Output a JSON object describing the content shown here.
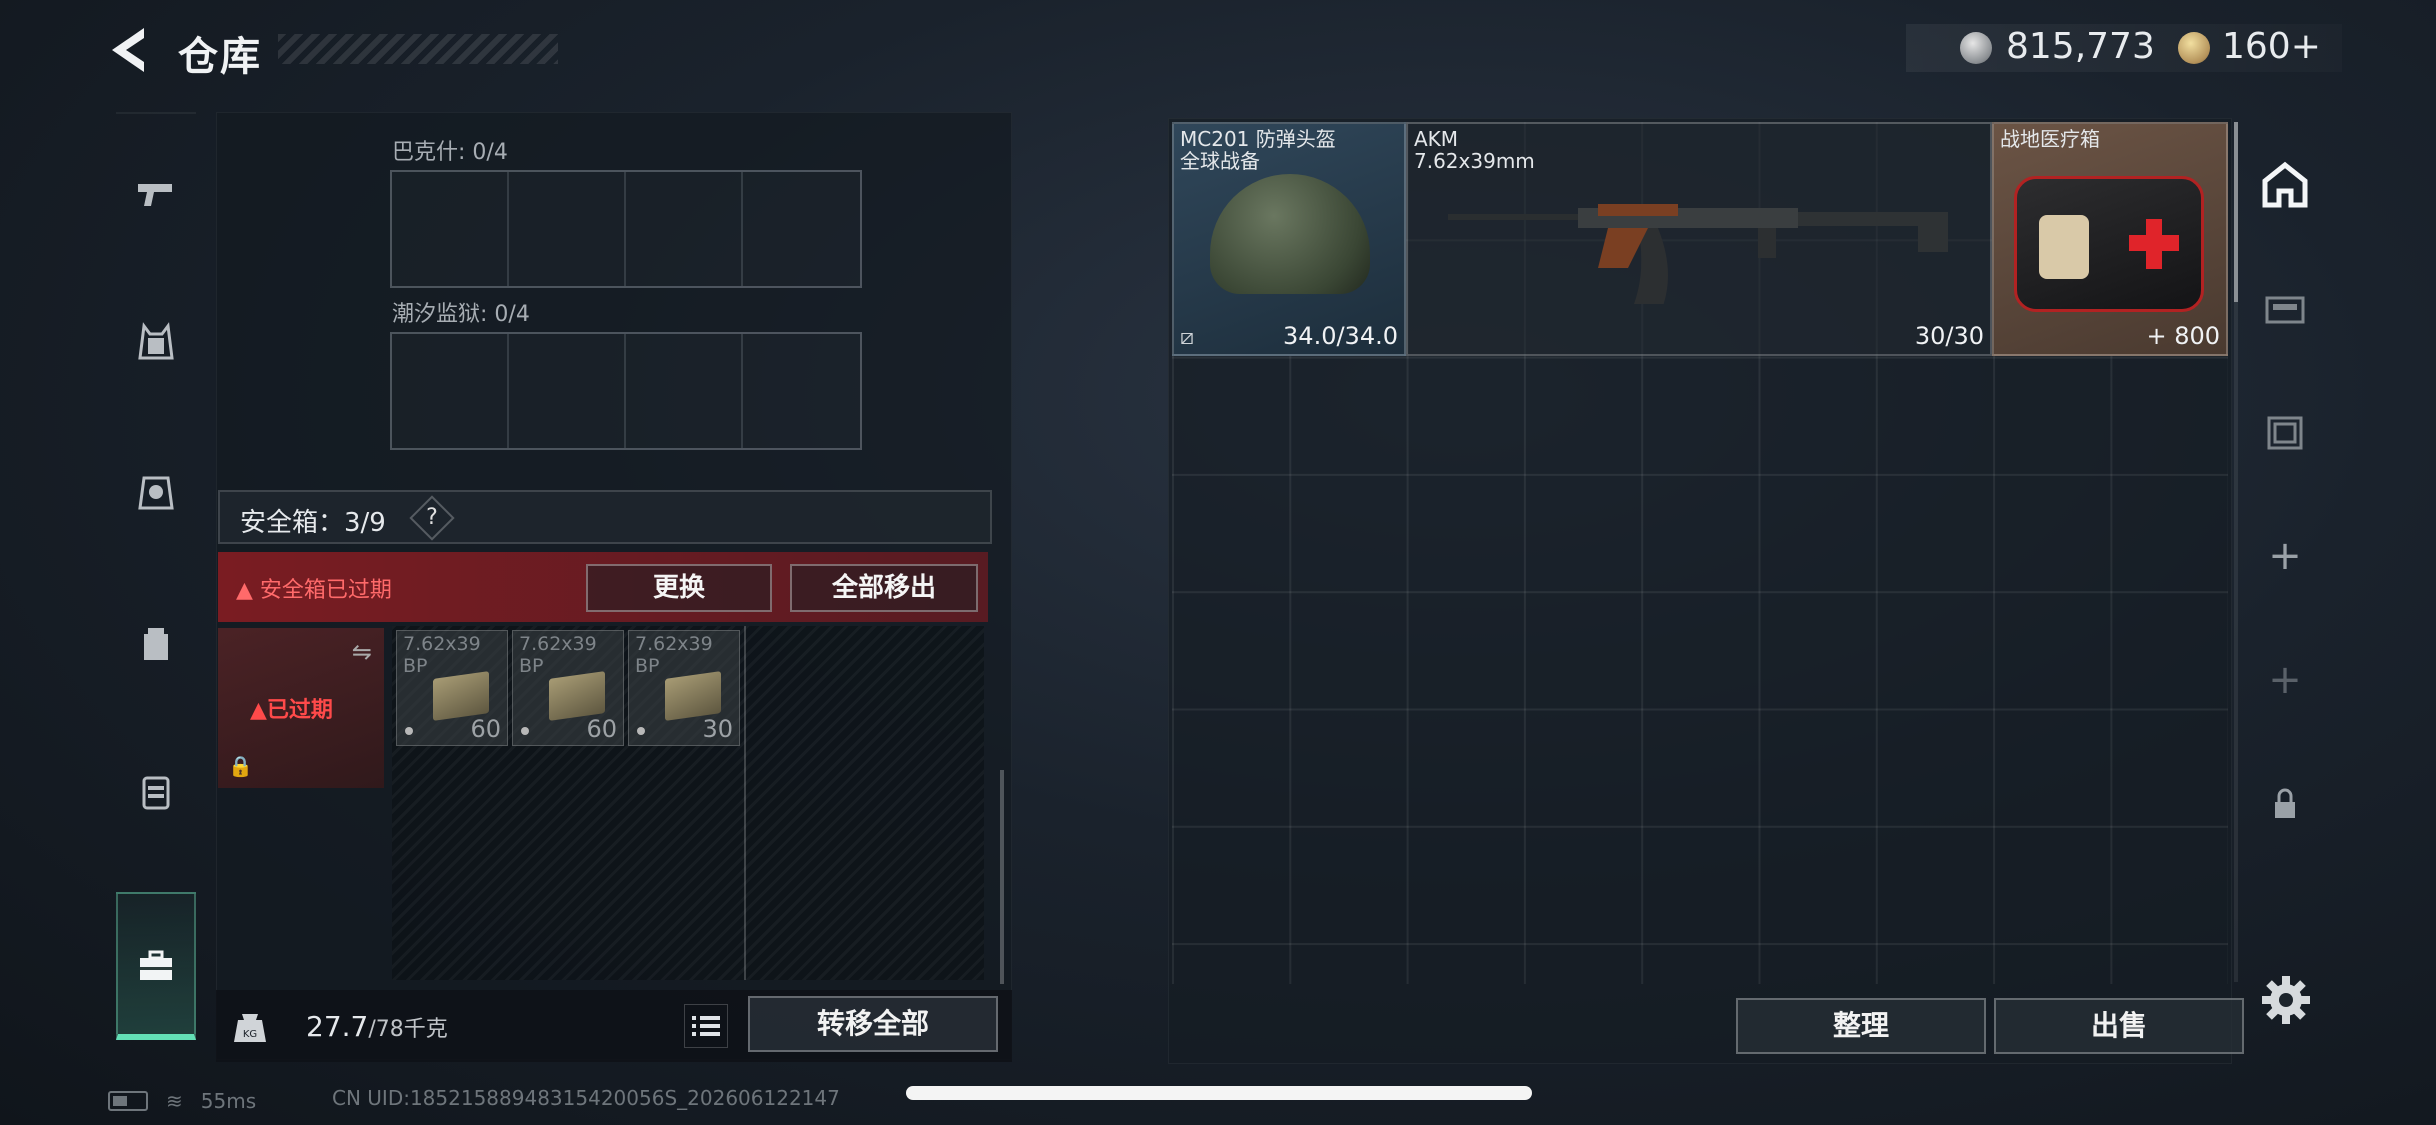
{
  "header": {
    "title": "仓库",
    "currencies": [
      {
        "name": "silver-coin",
        "amount": "815,773"
      },
      {
        "name": "gold-coin",
        "amount": "160+"
      }
    ]
  },
  "left_nav": {
    "items": [
      "pistol-icon",
      "armor-vest-icon",
      "chest-rig-icon",
      "backpack-icon",
      "case-icon",
      "toolbox-icon"
    ],
    "active": "toolbox-icon",
    "accent_color": "#63e0b6"
  },
  "key_slots": [
    {
      "label": "巴克什: 0/4"
    },
    {
      "label": "潮汐监狱: 0/4"
    }
  ],
  "safe_box": {
    "title": "安全箱：3/9",
    "help": "?",
    "expired_warning": "安全箱已过期",
    "replace_label": "更换",
    "move_all_out_label": "全部移出",
    "expired_badge": "已过期",
    "items": [
      {
        "name": "7.62x39\nBP",
        "qty": "60"
      },
      {
        "name": "7.62x39\nBP",
        "qty": "60"
      },
      {
        "name": "7.62x39\nBP",
        "qty": "30"
      }
    ]
  },
  "weight": {
    "current": "27.7",
    "max": "/78千克"
  },
  "transfer_all_label": "转移全部",
  "stash": {
    "items": [
      {
        "name": "MC201 防弹头盔\n全球战备",
        "bottom": "34.0/34.0"
      },
      {
        "name": "AKM\n7.62x39mm",
        "bottom": "30/30"
      },
      {
        "name": "战地医疗箱",
        "bottom": "+ 800"
      }
    ],
    "sort_label": "整理",
    "sell_label": "出售"
  },
  "right_rail": [
    "stash-icon",
    "container-icon",
    "container-icon",
    "+",
    "+",
    "lock-icon"
  ],
  "status_bar": {
    "ping": "55ms",
    "uid": "CN UID:18521588948315420056S_202606122147"
  },
  "colors": {
    "danger": "#ff4a4a",
    "accent": "#63e0b6"
  }
}
